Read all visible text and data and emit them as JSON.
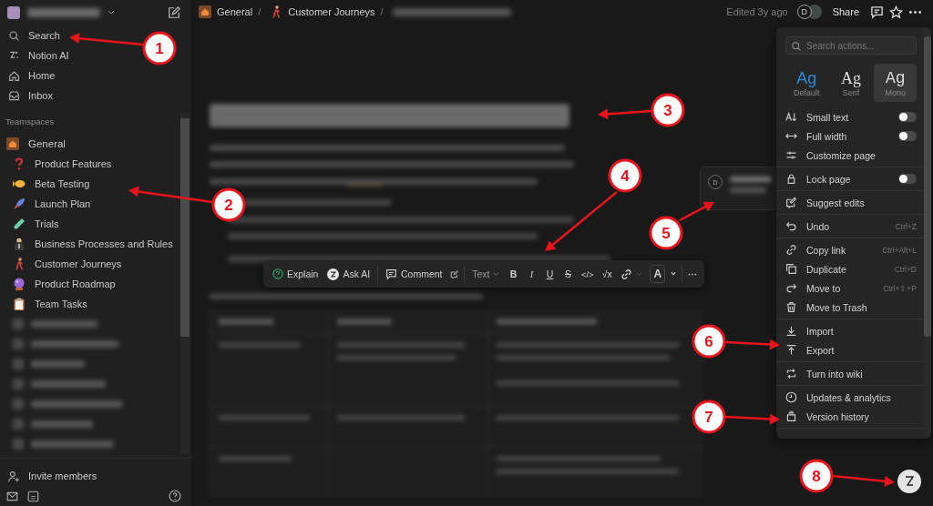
{
  "sidebar": {
    "nav": [
      {
        "label": "Search"
      },
      {
        "label": "Notion AI"
      },
      {
        "label": "Home"
      },
      {
        "label": "Inbox"
      }
    ],
    "section_title": "Teamspaces",
    "teamspace": {
      "label": "General",
      "children": [
        {
          "label": "Product Features"
        },
        {
          "label": "Beta Testing"
        },
        {
          "label": "Launch Plan"
        },
        {
          "label": "Trials"
        },
        {
          "label": "Business Processes and Rules"
        },
        {
          "label": "Customer Journeys"
        },
        {
          "label": "Product Roadmap"
        },
        {
          "label": "Team Tasks"
        }
      ]
    },
    "invite": "Invite members"
  },
  "breadcrumb": [
    {
      "label": "General",
      "separator": "/"
    },
    {
      "label": "Customer Journeys",
      "separator": "/"
    }
  ],
  "topbar": {
    "edited": "Edited 3y ago",
    "avatar": "D",
    "share": "Share"
  },
  "comment_popup": {
    "avatar": "D"
  },
  "toolbar": {
    "explain": "Explain",
    "ask_ai": "Ask AI",
    "comment": "Comment",
    "text_style": "Text",
    "format": [
      "B",
      "I",
      "U",
      "S",
      "</>",
      "√x"
    ],
    "font_color_button": "A"
  },
  "menu": {
    "search_placeholder": "Search actions...",
    "fonts": [
      {
        "sample": "Ag",
        "label": "Default",
        "selected": true,
        "hovered": false
      },
      {
        "sample": "Ag",
        "label": "Serif",
        "selected": false,
        "hovered": false
      },
      {
        "sample": "Ag",
        "label": "Mono",
        "selected": false,
        "hovered": true
      }
    ],
    "sections": [
      {
        "items": [
          {
            "label": "Small text",
            "kind": "toggle",
            "on": false
          },
          {
            "label": "Full width",
            "kind": "toggle",
            "on": false
          },
          {
            "label": "Customize page",
            "kind": "action"
          }
        ]
      },
      {
        "items": [
          {
            "label": "Lock page",
            "kind": "toggle",
            "on": false
          }
        ]
      },
      {
        "items": [
          {
            "label": "Suggest edits",
            "kind": "action"
          }
        ]
      },
      {
        "items": [
          {
            "label": "Undo",
            "kind": "shortcut",
            "shortcut": "Ctrl+Z"
          }
        ]
      },
      {
        "items": [
          {
            "label": "Copy link",
            "kind": "shortcut",
            "shortcut": "Ctrl+Alt+L"
          },
          {
            "label": "Duplicate",
            "kind": "shortcut",
            "shortcut": "Ctrl+D"
          },
          {
            "label": "Move to",
            "kind": "shortcut",
            "shortcut": "Ctrl+⇧+P"
          },
          {
            "label": "Move to Trash",
            "kind": "action"
          }
        ]
      },
      {
        "items": [
          {
            "label": "Import",
            "kind": "action"
          },
          {
            "label": "Export",
            "kind": "action"
          }
        ]
      },
      {
        "items": [
          {
            "label": "Turn into wiki",
            "kind": "action"
          }
        ]
      },
      {
        "items": [
          {
            "label": "Updates & analytics",
            "kind": "action"
          },
          {
            "label": "Version history",
            "kind": "action"
          }
        ]
      }
    ]
  },
  "annotations": [
    {
      "label": "1"
    },
    {
      "label": "2"
    },
    {
      "label": "3"
    },
    {
      "label": "4"
    },
    {
      "label": "5"
    },
    {
      "label": "6"
    },
    {
      "label": "7"
    },
    {
      "label": "8"
    }
  ]
}
